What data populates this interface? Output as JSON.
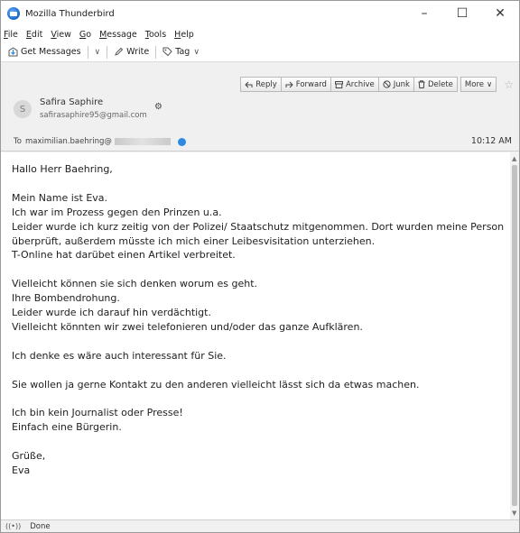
{
  "window": {
    "title": "Mozilla Thunderbird",
    "controls": [
      "–",
      "☐",
      "✕"
    ]
  },
  "menu": [
    {
      "ul": "F",
      "rest": "ile"
    },
    {
      "ul": "E",
      "rest": "dit"
    },
    {
      "ul": "V",
      "rest": "iew"
    },
    {
      "ul": "G",
      "rest": "o"
    },
    {
      "ul": "M",
      "rest": "essage"
    },
    {
      "ul": "T",
      "rest": "ools"
    },
    {
      "ul": "H",
      "rest": "elp"
    }
  ],
  "toolbar": {
    "get_messages": "Get Messages",
    "write": "Write",
    "tag": "Tag",
    "chevron": "∨"
  },
  "header": {
    "buttons": {
      "reply": "Reply",
      "forward": "Forward",
      "archive": "Archive",
      "junk": "Junk",
      "delete": "Delete",
      "more": "More"
    },
    "sender_name": "Safira Saphire",
    "sender_email": "safirasaphire95@gmail.com",
    "sender_initial": "S",
    "to_label": "To",
    "to_address": "maximilian.baehring@",
    "date": "10:12 AM"
  },
  "body": "Hallo Herr Baehring,\n\nMein Name ist Eva.\nIch war im Prozess gegen den Prinzen u.a.\nLeider wurde ich kurz zeitig von der Polizei/ Staatschutz mitgenommen. Dort wurden meine Person überprüft, außerdem müsste ich mich einer Leibesvisitation unterziehen.\nT-Online hat darübet einen Artikel verbreitet.\n\nVielleicht können sie sich denken worum es geht.\nIhre Bombendrohung.\nLeider wurde ich darauf hin verdächtigt.\nVielleicht könnten wir zwei telefonieren und/oder das ganze Aufklären.\n\nIch denke es wäre auch interessant für Sie.\n\nSie wollen ja gerne Kontakt zu den anderen vielleicht lässt sich da etwas machen.\n\nIch bin kein Journalist oder Presse!\nEinfach eine Bürgerin.\n\nGrüße,\nEva",
  "status": {
    "icon": "((•))",
    "text": "Done"
  },
  "colors": {
    "accent": "#2d8ae0",
    "chrome": "#f0f0f0",
    "content": "#ffffff"
  }
}
